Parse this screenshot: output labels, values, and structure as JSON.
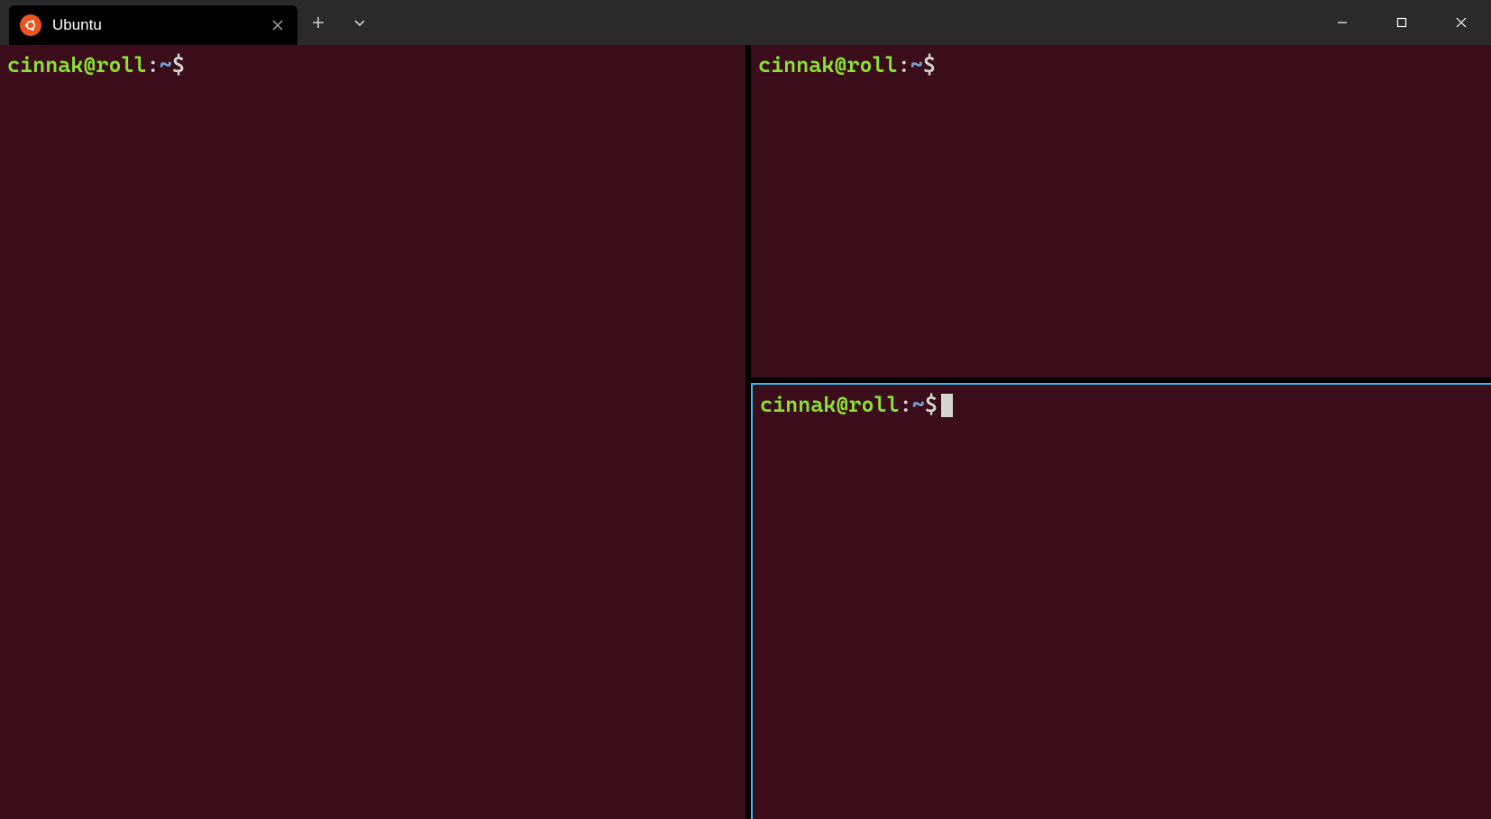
{
  "tabs": [
    {
      "title": "Ubuntu",
      "icon": "ubuntu-icon"
    }
  ],
  "panes": {
    "left": {
      "user_host": "cinnak@roll",
      "sep": ":",
      "path": "~",
      "dollar": "$"
    },
    "top": {
      "user_host": "cinnak@roll",
      "sep": ":",
      "path": "~",
      "dollar": "$"
    },
    "bottom": {
      "user_host": "cinnak@roll",
      "sep": ":",
      "path": "~",
      "dollar": "$"
    }
  },
  "colors": {
    "terminal_bg": "#3b0d1b",
    "accent": "#3db7e4",
    "prompt_user": "#8ae234",
    "prompt_path": "#729fcf",
    "prompt_text": "#d3d7cf"
  }
}
